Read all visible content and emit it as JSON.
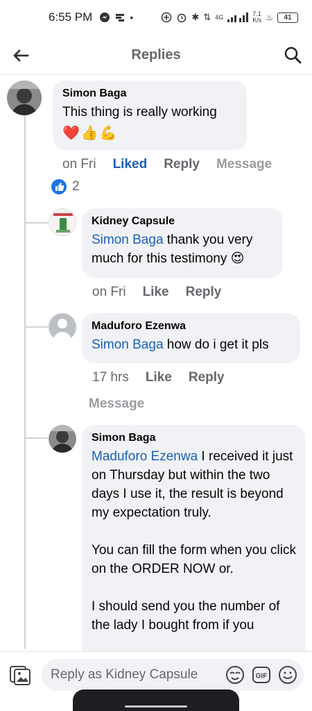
{
  "status_bar": {
    "time": "6:55 PM",
    "network_speed": "7.1\nK/s",
    "network_type": "4G",
    "battery": "41"
  },
  "header": {
    "title": "Replies"
  },
  "comments": [
    {
      "author": "Simon Baga",
      "text": "This thing is really working",
      "emojis": [
        "❤️",
        "👍",
        "💪"
      ],
      "time": "on Fri",
      "actions": [
        "Liked",
        "Reply",
        "Message"
      ],
      "reaction_count": "2"
    },
    {
      "author": "Kidney Capsule",
      "mention": "Simon Baga",
      "text": " thank you very much for this testimony 😍",
      "time": "on Fri",
      "actions": [
        "Like",
        "Reply"
      ]
    },
    {
      "author": "Maduforo Ezenwa",
      "mention": "Simon Baga",
      "text": " how do i get it pls",
      "time": "17 hrs",
      "actions": [
        "Like",
        "Reply",
        "Message"
      ]
    },
    {
      "author": "Simon Baga",
      "mention": "Maduforo Ezenwa",
      "text": " I received it just on Thursday but within the two days I use it, the result is beyond my expectation truly.",
      "paragraph2": "You can fill the form when you click on the ORDER NOW or.",
      "paragraph3": "I should send you the number of the lady I bought from if you"
    }
  ],
  "reply_box": {
    "placeholder": "Reply as Kidney Capsule"
  },
  "icons": {
    "back": "arrow-left-icon",
    "search": "search-icon",
    "gallery": "gallery-icon",
    "avatar_sticker": "avatar-sticker-icon",
    "gif": "gif-icon",
    "emoji": "emoji-icon",
    "like_reaction": "like-reaction-icon"
  },
  "colors": {
    "accent": "#1b5fb8",
    "bubble": "#f0f2f5",
    "secondary_text": "#65676b"
  }
}
